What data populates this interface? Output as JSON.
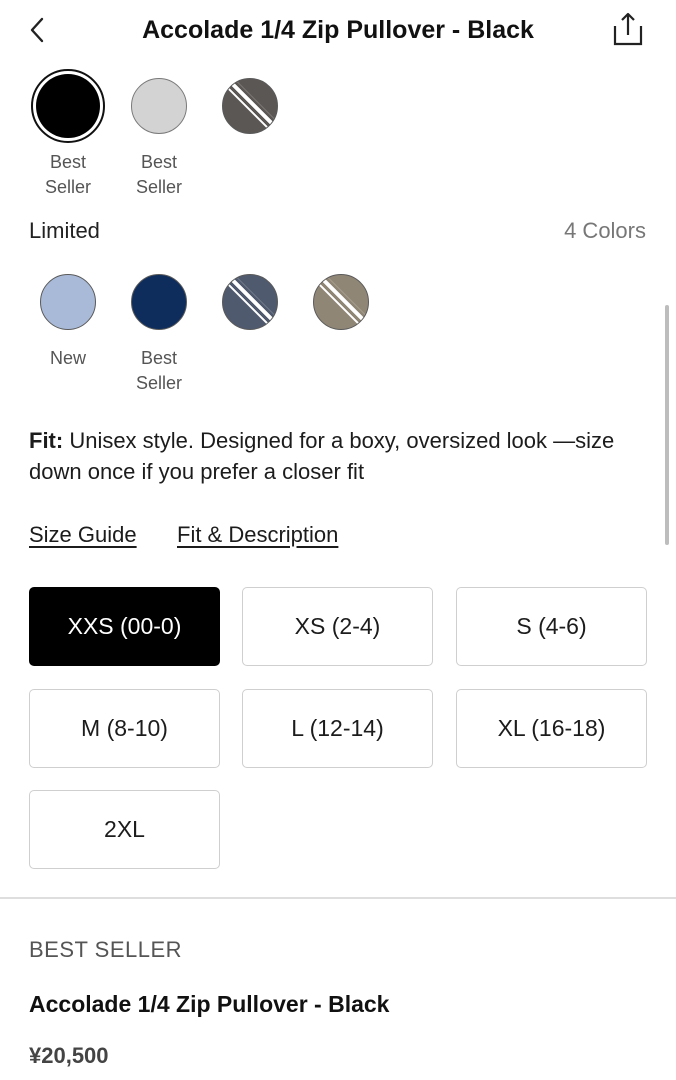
{
  "header": {
    "title": "Accolade 1/4 Zip Pullover - Black",
    "back_icon": "chevron-left-icon",
    "share_icon": "share-icon"
  },
  "colors_top": [
    {
      "name": "black",
      "color": "#000000",
      "striped": false,
      "selected": true,
      "label_line1": "Best",
      "label_line2": "Seller"
    },
    {
      "name": "light-grey",
      "color": "#d3d3d3",
      "striped": false,
      "selected": false,
      "label_line1": "Best",
      "label_line2": "Seller"
    },
    {
      "name": "dark-grey-stripe",
      "color": "#5b5755",
      "striped": true,
      "selected": false,
      "label_line1": "",
      "label_line2": ""
    }
  ],
  "limited": {
    "label": "Limited",
    "count": "4 Colors"
  },
  "colors_limited": [
    {
      "name": "light-blue",
      "color": "#a9bad9",
      "striped": false,
      "label_line1": "New",
      "label_line2": ""
    },
    {
      "name": "navy",
      "color": "#0f2d5c",
      "striped": false,
      "label_line1": "Best",
      "label_line2": "Seller"
    },
    {
      "name": "slate-stripe",
      "color": "#4f5a6e",
      "striped": true,
      "label_line1": "",
      "label_line2": ""
    },
    {
      "name": "taupe-stripe",
      "color": "#908676",
      "striped": true,
      "label_line1": "",
      "label_line2": ""
    }
  ],
  "fit": {
    "label": "Fit:",
    "text": " Unisex style. Designed for a boxy, oversized look —size down once if you prefer a closer fit"
  },
  "links": {
    "size_guide": "Size Guide",
    "fit_description": "Fit & Description"
  },
  "sizes": [
    {
      "label": "XXS (00-0)",
      "selected": true
    },
    {
      "label": "XS (2-4)",
      "selected": false
    },
    {
      "label": "S (4-6)",
      "selected": false
    },
    {
      "label": "M (8-10)",
      "selected": false
    },
    {
      "label": "L (12-14)",
      "selected": false
    },
    {
      "label": "XL (16-18)",
      "selected": false
    },
    {
      "label": "2XL",
      "selected": false
    }
  ],
  "summary": {
    "badge": "BEST SELLER",
    "product_name": "Accolade 1/4 Zip Pullover - Black",
    "price": "¥20,500"
  }
}
